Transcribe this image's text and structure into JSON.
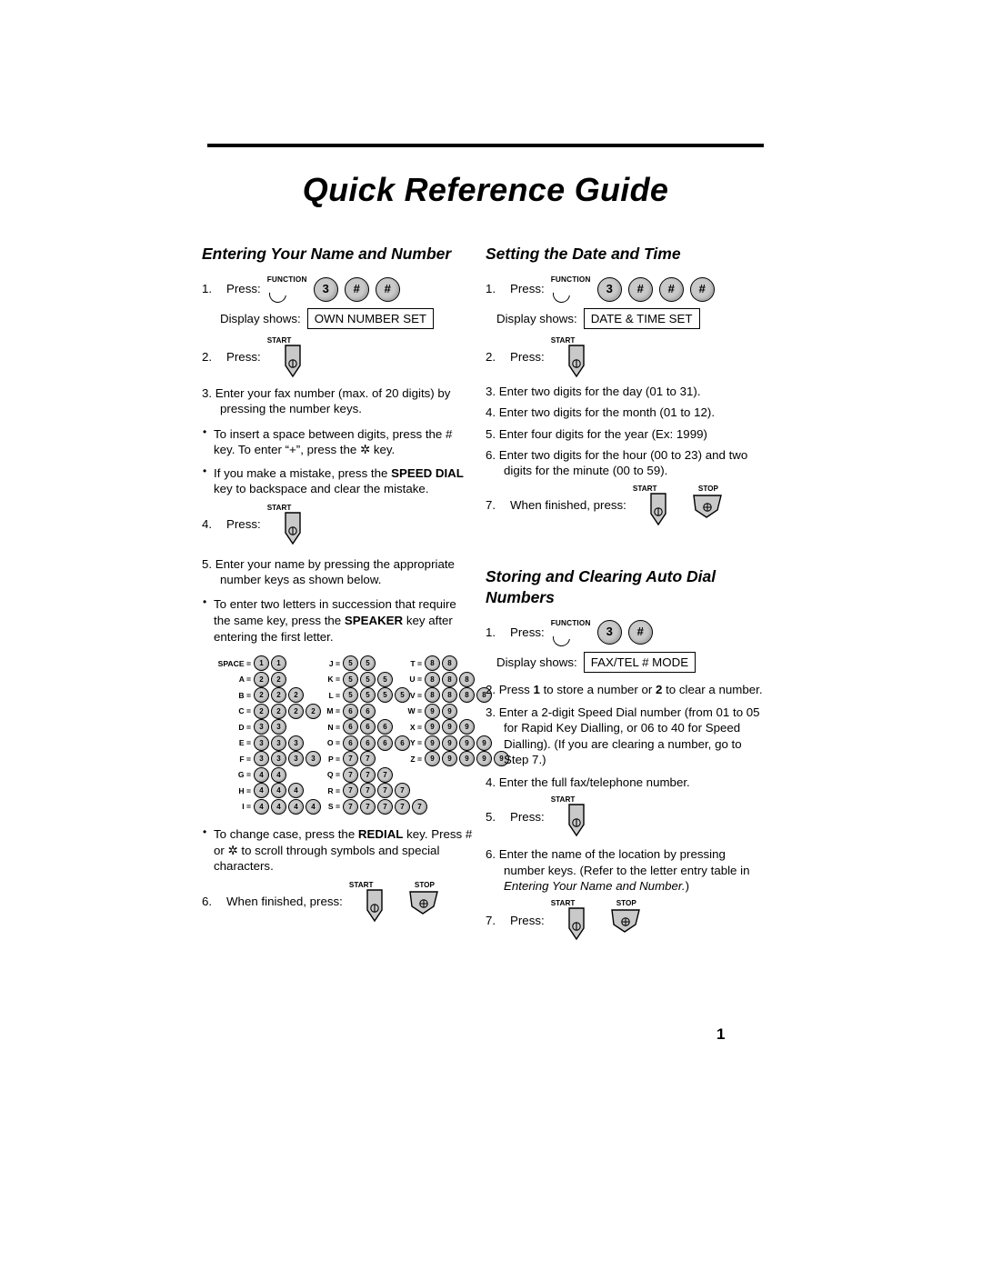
{
  "document": {
    "title": "Quick Reference Guide",
    "page_number": "1"
  },
  "labels": {
    "press": "Press:",
    "display_shows": "Display shows:",
    "when_finished_press": "When finished, press:",
    "function_cap": "FUNCTION",
    "start_cap": "START",
    "stop_cap": "STOP"
  },
  "sections": {
    "name_number": {
      "heading": "Entering Your Name and Number",
      "step1_num": "1.",
      "step1_label": "Press:",
      "step1_keys": [
        "3",
        "#",
        "#"
      ],
      "display_label": "Display shows:",
      "display_value": "OWN NUMBER SET",
      "step2_num": "2.",
      "step2_label": "Press:",
      "step3_num": "3.",
      "step3_text": "Enter your fax number (max. of 20 digits) by pressing the number keys.",
      "bullet1_a": "To insert  a space between digits, press the # key. To enter “+”, press the ",
      "bullet1_b": " key.",
      "bullet2_a": "If you make a mistake, press the ",
      "bullet2_bold1": "SPEED DIAL",
      "bullet2_b": " key to backspace and clear the mistake.",
      "step4_num": "4.",
      "step4_label": "Press:",
      "step5_num": "5.",
      "step5_text": "Enter your name by pressing the appropriate number keys as shown below.",
      "bullet3_a": "To enter two letters in succession that require the same key, press the ",
      "bullet3_bold": "SPEAKER",
      "bullet3_b": " key after entering the first letter.",
      "bullet4_a": "To change case, press the ",
      "bullet4_bold": "REDIAL",
      "bullet4_b": " key. Press # or ",
      "bullet4_c": " to scroll through symbols and special characters.",
      "step6_num": "6.",
      "step6_label": "When finished, press:"
    },
    "date_time": {
      "heading": "Setting the Date and Time",
      "step1_num": "1.",
      "step1_label": "Press:",
      "step1_keys": [
        "3",
        "#",
        "#",
        "#"
      ],
      "display_label": "Display shows:",
      "display_value": "DATE & TIME SET",
      "step2_num": "2.",
      "step2_label": "Press:",
      "step3_num": "3.",
      "step3_text": "Enter two digits for the day (01 to 31).",
      "step4_num": "4.",
      "step4_text": "Enter two digits for the month (01 to 12).",
      "step5_num": "5.",
      "step5_text": "Enter four digits for the year (Ex: 1999)",
      "step6_num": "6.",
      "step6_text": "Enter two digits for the hour (00 to 23) and two digits for the minute (00 to 59).",
      "step7_num": "7.",
      "step7_label": "When finished, press:"
    },
    "auto_dial": {
      "heading": "Storing and Clearing Auto Dial Numbers",
      "step1_num": "1.",
      "step1_label": "Press:",
      "step1_keys": [
        "3",
        "#"
      ],
      "display_label": "Display shows:",
      "display_value": "FAX/TEL # MODE",
      "step2_num": "2.",
      "step2_a": "Press ",
      "step2_bold1": "1",
      "step2_b": " to store a number or ",
      "step2_bold2": "2",
      "step2_c": " to clear a number.",
      "step3_num": "3.",
      "step3_text": "Enter a 2-digit Speed Dial number (from 01 to 05 for Rapid Key Dialling, or 06 to 40 for Speed Dialling). (If you are clearing a number, go to Step 7.)",
      "step4_num": "4.",
      "step4_text": "Enter the full fax/telephone number.",
      "step5_num": "5.",
      "step5_label": "Press:",
      "step6_num": "6.",
      "step6_a": "Enter the name of the location by pressing number keys. (Refer to the letter entry table in ",
      "step6_italic": "Entering Your Name and Number.",
      "step6_b": ")",
      "step7_num": "7.",
      "step7_label": "Press:"
    }
  },
  "letter_table": {
    "columns": [
      {
        "rows": [
          {
            "key": "SPACE =",
            "digits": [
              "1",
              "1"
            ]
          },
          {
            "key": "A =",
            "digits": [
              "2",
              "2"
            ]
          },
          {
            "key": "B =",
            "digits": [
              "2",
              "2",
              "2"
            ]
          },
          {
            "key": "C =",
            "digits": [
              "2",
              "2",
              "2",
              "2"
            ]
          },
          {
            "key": "D =",
            "digits": [
              "3",
              "3"
            ]
          },
          {
            "key": "E =",
            "digits": [
              "3",
              "3",
              "3"
            ]
          },
          {
            "key": "F =",
            "digits": [
              "3",
              "3",
              "3",
              "3"
            ]
          },
          {
            "key": "G =",
            "digits": [
              "4",
              "4"
            ]
          },
          {
            "key": "H =",
            "digits": [
              "4",
              "4",
              "4"
            ]
          },
          {
            "key": "I =",
            "digits": [
              "4",
              "4",
              "4",
              "4"
            ]
          }
        ]
      },
      {
        "rows": [
          {
            "key": "J =",
            "digits": [
              "5",
              "5"
            ]
          },
          {
            "key": "K =",
            "digits": [
              "5",
              "5",
              "5"
            ]
          },
          {
            "key": "L =",
            "digits": [
              "5",
              "5",
              "5",
              "5"
            ]
          },
          {
            "key": "M =",
            "digits": [
              "6",
              "6"
            ]
          },
          {
            "key": "N =",
            "digits": [
              "6",
              "6",
              "6"
            ]
          },
          {
            "key": "O =",
            "digits": [
              "6",
              "6",
              "6",
              "6"
            ]
          },
          {
            "key": "P =",
            "digits": [
              "7",
              "7"
            ]
          },
          {
            "key": "Q =",
            "digits": [
              "7",
              "7",
              "7"
            ]
          },
          {
            "key": "R =",
            "digits": [
              "7",
              "7",
              "7",
              "7"
            ]
          },
          {
            "key": "S =",
            "digits": [
              "7",
              "7",
              "7",
              "7",
              "7"
            ]
          }
        ]
      },
      {
        "rows": [
          {
            "key": "T =",
            "digits": [
              "8",
              "8"
            ]
          },
          {
            "key": "U =",
            "digits": [
              "8",
              "8",
              "8"
            ]
          },
          {
            "key": "V =",
            "digits": [
              "8",
              "8",
              "8",
              "8"
            ]
          },
          {
            "key": "W =",
            "digits": [
              "9",
              "9"
            ]
          },
          {
            "key": "X =",
            "digits": [
              "9",
              "9",
              "9"
            ]
          },
          {
            "key": "Y =",
            "digits": [
              "9",
              "9",
              "9",
              "9"
            ]
          },
          {
            "key": "Z =",
            "digits": [
              "9",
              "9",
              "9",
              "9",
              "9"
            ]
          }
        ]
      }
    ]
  }
}
